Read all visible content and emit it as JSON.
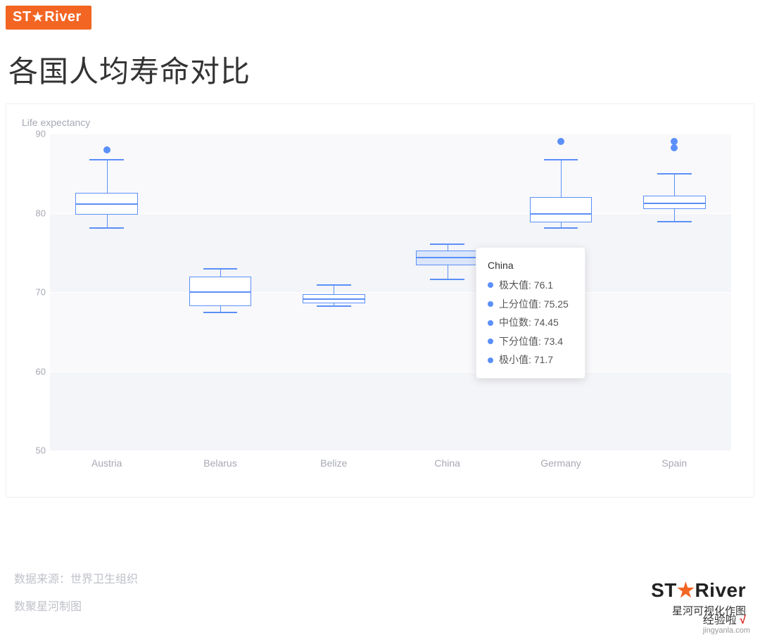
{
  "brand": {
    "logo_text": "ST★River"
  },
  "title": "各国人均寿命对比",
  "ylabel": "Life expectancy",
  "yaxis": {
    "min": 50,
    "max": 90,
    "ticks": [
      50,
      60,
      70,
      80,
      90
    ],
    "band_alt": true
  },
  "chart_data": {
    "type": "boxplot",
    "ylabel": "Life expectancy",
    "ylim": [
      50,
      90
    ],
    "categories": [
      "Austria",
      "Belarus",
      "Belize",
      "China",
      "Germany",
      "Spain"
    ],
    "series": [
      {
        "name": "Austria",
        "min": 78.2,
        "q1": 79.8,
        "median": 81.2,
        "q3": 82.5,
        "max": 86.8,
        "outliers": [
          88.0
        ]
      },
      {
        "name": "Belarus",
        "min": 67.5,
        "q1": 68.2,
        "median": 70.1,
        "q3": 72.0,
        "max": 73.0,
        "outliers": []
      },
      {
        "name": "Belize",
        "min": 68.3,
        "q1": 68.6,
        "median": 69.2,
        "q3": 69.7,
        "max": 71.0,
        "outliers": []
      },
      {
        "name": "China",
        "min": 71.7,
        "q1": 73.4,
        "median": 74.45,
        "q3": 75.25,
        "max": 76.1,
        "outliers": []
      },
      {
        "name": "Germany",
        "min": 78.2,
        "q1": 78.8,
        "median": 80.0,
        "q3": 82.0,
        "max": 86.8,
        "outliers": [
          89.0
        ]
      },
      {
        "name": "Spain",
        "min": 79.0,
        "q1": 80.5,
        "median": 81.3,
        "q3": 82.2,
        "max": 85.0,
        "outliers": [
          88.2,
          89.0
        ]
      }
    ]
  },
  "tooltip": {
    "visible_for": "China",
    "title": "China",
    "rows": [
      {
        "label": "极大值",
        "value": "76.1"
      },
      {
        "label": "上分位值",
        "value": "75.25"
      },
      {
        "label": "中位数",
        "value": "74.45"
      },
      {
        "label": "下分位值",
        "value": "73.4"
      },
      {
        "label": "极小值",
        "value": "71.7"
      }
    ]
  },
  "footer": {
    "source_line": "数据来源：世界卫生组织",
    "maker_line": "数聚星河制图",
    "right_brand_prefix": "ST",
    "right_brand_star": "★",
    "right_brand_suffix": "River",
    "right_sub": "星河可视化作图"
  },
  "watermark": {
    "text": "经验啦",
    "check": "√",
    "domain": "jingyanla.com"
  }
}
